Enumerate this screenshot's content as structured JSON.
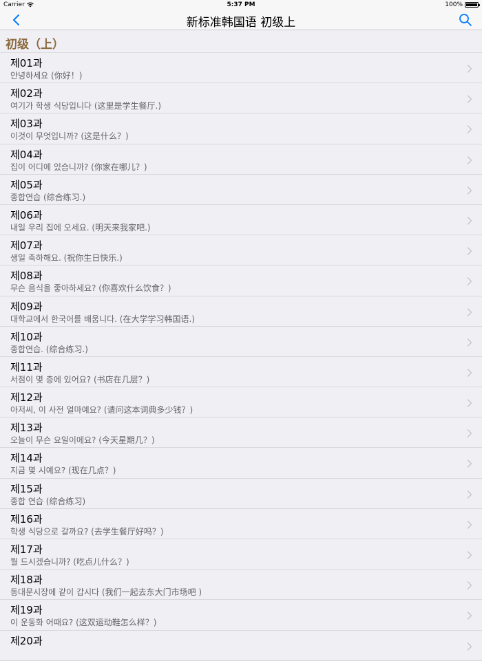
{
  "status": {
    "carrier": "Carrier",
    "time": "5:37 PM",
    "battery": "100%"
  },
  "nav": {
    "title": "新标准韩国语 初级上"
  },
  "section": {
    "title": "初级（上）"
  },
  "lessons": [
    {
      "title": "제01과",
      "subtitle": "안녕하세요 (你好！)"
    },
    {
      "title": "제02과",
      "subtitle": "여기가 학생 식당입니다  (这里是学生餐厅.)"
    },
    {
      "title": "제03과",
      "subtitle": "이것이 무엇입니까? (这是什么？)"
    },
    {
      "title": "제04과",
      "subtitle": "집이 어디에 있습니까? (你家在哪儿？)"
    },
    {
      "title": "제05과",
      "subtitle": "종합연습 (综合练习.)"
    },
    {
      "title": "제06과",
      "subtitle": "내일 우리 집에 오세요.  (明天来我家吧.)"
    },
    {
      "title": "제07과",
      "subtitle": "생일 축하해요. (祝你生日快乐.)"
    },
    {
      "title": "제08과",
      "subtitle": "무슨 음식을 좋아하세요? (你喜欢什么饮食？)"
    },
    {
      "title": "제09과",
      "subtitle": "대학교에서 한국어를 배웁니다. (在大学学习韩国语.)"
    },
    {
      "title": "제10과",
      "subtitle": "종합연습. (综合练习.)"
    },
    {
      "title": "제11과",
      "subtitle": "서점이 몇 층에 있어요? (书店在几层？)"
    },
    {
      "title": "제12과",
      "subtitle": "아저씨, 이 사전 얼마예요? (请问这本词典多少钱？)"
    },
    {
      "title": "제13과",
      "subtitle": "오늘이 무슨 요일이에요? (今天星期几？)"
    },
    {
      "title": "제14과",
      "subtitle": "지금 몇 시예요? (现在几点？)"
    },
    {
      "title": "제15과",
      "subtitle": "종합 연습 (综合练习)"
    },
    {
      "title": "제16과",
      "subtitle": "학생 식당으로 갈까요? (去学生餐厅好吗？)"
    },
    {
      "title": "제17과",
      "subtitle": "뭘 드시겠습니까? (吃点儿什么？)"
    },
    {
      "title": "제18과",
      "subtitle": "동대문시장에 같이 갑시다 (我们一起去东大门市场吧 )"
    },
    {
      "title": "제19과",
      "subtitle": "이 운동화 어때요? (这双运动鞋怎么样？)"
    },
    {
      "title": "제20과",
      "subtitle": ""
    }
  ],
  "icons": {
    "back": "chevron-left-icon",
    "search": "search-icon",
    "row_chevron": "chevron-right-icon",
    "wifi": "wifi-icon"
  },
  "colors": {
    "accent": "#007aff",
    "section_title": "#8b6a3e",
    "background": "#efeff4"
  }
}
